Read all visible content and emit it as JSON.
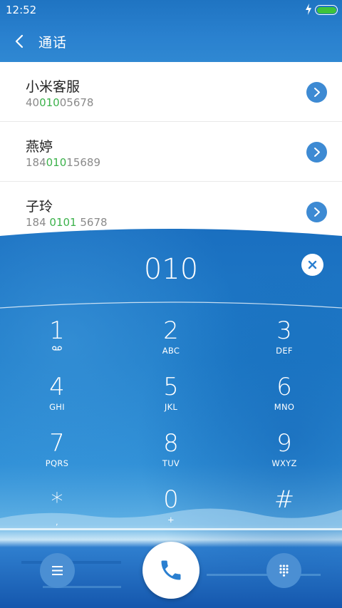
{
  "status_bar": {
    "time": "12:52",
    "battery_color": "#3ec33a"
  },
  "header": {
    "title": "通话",
    "back_icon": "chevron-left-icon"
  },
  "results": [
    {
      "name": "小米客服",
      "number_parts": [
        "40",
        "010",
        "05678"
      ]
    },
    {
      "name": "燕婷",
      "number_parts": [
        "184",
        "010",
        "15689"
      ]
    },
    {
      "name": "子玲",
      "number_parts": [
        "184 ",
        "0101",
        " 5678"
      ]
    }
  ],
  "dialer": {
    "input": "010",
    "keys": [
      {
        "digit": "1",
        "letters": ""
      },
      {
        "digit": "2",
        "letters": "ABC"
      },
      {
        "digit": "3",
        "letters": "DEF"
      },
      {
        "digit": "4",
        "letters": "GHI"
      },
      {
        "digit": "5",
        "letters": "JKL"
      },
      {
        "digit": "6",
        "letters": "MNO"
      },
      {
        "digit": "7",
        "letters": "PQRS"
      },
      {
        "digit": "8",
        "letters": "TUV"
      },
      {
        "digit": "9",
        "letters": "WXYZ"
      },
      {
        "digit": "*",
        "letters": ","
      },
      {
        "digit": "0",
        "letters": "+"
      },
      {
        "digit": "#",
        "letters": ""
      }
    ]
  },
  "colors": {
    "accent_blue": "#3d8ad3",
    "match_green": "#3cb24b",
    "header_blue": "#2a81cf"
  },
  "icons": {
    "clear": "clear-icon",
    "voicemail": "voicemail-icon",
    "menu": "menu-icon",
    "call": "phone-icon",
    "keypad": "keypad-icon",
    "row_arrow": "chevron-right-icon"
  }
}
